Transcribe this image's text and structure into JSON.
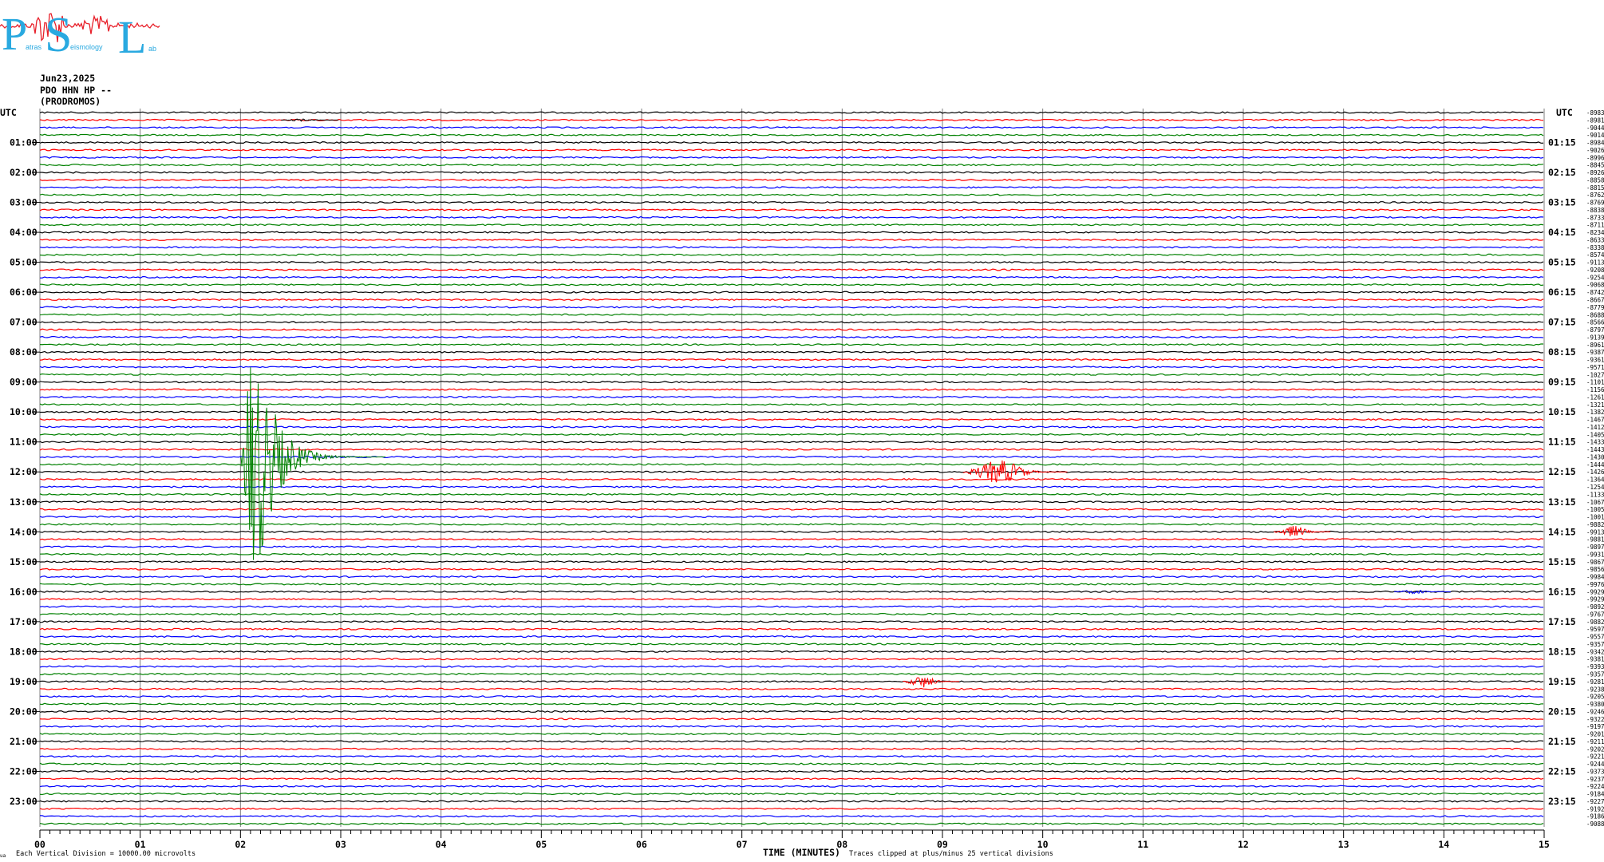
{
  "logo": {
    "text_main": "PSL",
    "text_small_1": "atras",
    "text_small_2": "eismology",
    "text_small_3": "ab",
    "colors": {
      "letters": "#29a9e0",
      "trace": "#e8202a"
    }
  },
  "header": {
    "date": "Jun23,2025",
    "channel": "PDO HHN HP --",
    "station": "(PRODROMOS)"
  },
  "chart_data": {
    "type": "line",
    "title": "",
    "xlabel": "TIME (MINUTES)",
    "x_ticks": [
      "00",
      "01",
      "02",
      "03",
      "04",
      "05",
      "06",
      "07",
      "08",
      "09",
      "10",
      "11",
      "12",
      "13",
      "14",
      "15"
    ],
    "xlim": [
      0,
      15
    ],
    "left_axis_title": "UTC",
    "right_axis_title": "UTC",
    "left_hour_labels": [
      "01:00",
      "02:00",
      "03:00",
      "04:00",
      "05:00",
      "06:00",
      "07:00",
      "08:00",
      "09:00",
      "10:00",
      "11:00",
      "12:00",
      "13:00",
      "14:00",
      "15:00",
      "16:00",
      "17:00",
      "18:00",
      "19:00",
      "20:00",
      "21:00",
      "22:00",
      "23:00"
    ],
    "right_hour_labels": [
      "01:15",
      "02:15",
      "03:15",
      "04:15",
      "05:15",
      "06:15",
      "07:15",
      "08:15",
      "09:15",
      "10:15",
      "11:15",
      "12:15",
      "13:15",
      "14:15",
      "15:15",
      "16:15",
      "17:15",
      "18:15",
      "19:15",
      "20:15",
      "21:15",
      "22:15",
      "23:15"
    ],
    "trace_count": 96,
    "trace_minutes": 15,
    "trace_colors": [
      "#000000",
      "#ff0000",
      "#0000ff",
      "#008000"
    ],
    "line_offsets": [
      "-8983",
      "-8981",
      "-9044",
      "-9014",
      "-8984",
      "-9026",
      "-8996",
      "-8845",
      "-8926",
      "-8858",
      "-8815",
      "-8762",
      "-8769",
      "-8838",
      "-8733",
      "-8711",
      "-8234",
      "-8633",
      "-8338",
      "-8574",
      "-9113",
      "-9208",
      "-9254",
      "-9068",
      "-8742",
      "-8667",
      "-8779",
      "-8688",
      "-8566",
      "-8797",
      "-9139",
      "-8961",
      "-9387",
      "-9361",
      "-9571",
      "-10278",
      "-11017",
      "-11563",
      "-12614",
      "-13218",
      "-13829",
      "-14679",
      "-14121",
      "-14051",
      "-14335",
      "-14432",
      "-14306",
      "-14446",
      "-14269",
      "-13643",
      "-12541",
      "-11332",
      "-10672",
      "-10054",
      "-10017",
      "-9882",
      "-9913",
      "-9881",
      "-9897",
      "-9931",
      "-9867",
      "-9856",
      "-9984",
      "-9976",
      "-9929",
      "-9929",
      "-9892",
      "-9767",
      "-9882",
      "-9597",
      "-9557",
      "-9357",
      "-9342",
      "-9381",
      "-9393",
      "-9357",
      "-9281",
      "-9238",
      "-9205",
      "-9380",
      "-9246",
      "-9322",
      "-9197",
      "-9201",
      "-9211",
      "-9202",
      "-9221",
      "-9244",
      "-9373",
      "-9237",
      "-9224",
      "-9184",
      "-9227",
      "-9192",
      "-9186",
      "-9088"
    ],
    "events": [
      {
        "trace": 1,
        "minute": 2.5,
        "amplitude": 0.6,
        "color_index": 0
      },
      {
        "trace": 46,
        "minute": 2.1,
        "amplitude": 60,
        "color_index": 3
      },
      {
        "trace": 48,
        "minute": 9.3,
        "amplitude": 6,
        "color_index": 1
      },
      {
        "trace": 56,
        "minute": 12.4,
        "amplitude": 3,
        "color_index": 1
      },
      {
        "trace": 64,
        "minute": 13.6,
        "amplitude": 1,
        "color_index": 2
      },
      {
        "trace": 76,
        "minute": 8.7,
        "amplitude": 3,
        "color_index": 1
      }
    ],
    "grid": true
  },
  "footer": {
    "scale_note": "Each Vertical Division = 10000.00 microvolts",
    "time_label": "TIME (MINUTES)",
    "clip_note": "Traces clipped at plus/minus 25 vertical divisions",
    "corner_mark": "ua"
  }
}
